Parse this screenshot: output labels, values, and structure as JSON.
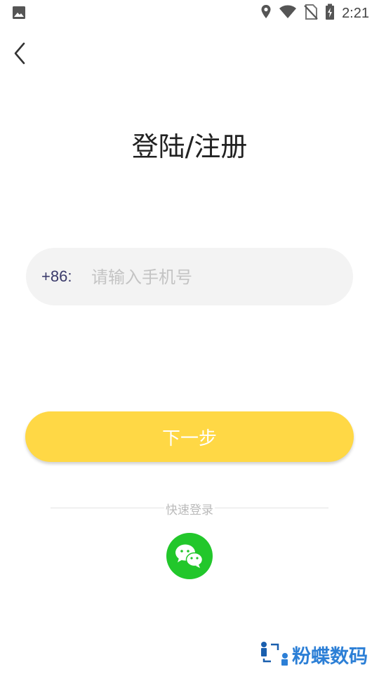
{
  "status_bar": {
    "time": "2:21",
    "icons": [
      "image-icon",
      "location-icon",
      "wifi-icon",
      "no-sim-icon",
      "battery-charging-icon"
    ]
  },
  "header": {
    "back_icon": "chevron-left-icon"
  },
  "title": "登陆/注册",
  "phone_input": {
    "country_code": "+86:",
    "placeholder": "请输入手机号",
    "value": ""
  },
  "next_button": {
    "label": "下一步"
  },
  "quick_login": {
    "label": "快速登录",
    "wechat_icon": "wechat-icon"
  },
  "watermark": {
    "text": "粉蝶数码"
  },
  "colors": {
    "accent": "#ffd845",
    "wechat": "#22c72b",
    "input_bg": "#f3f3f3",
    "watermark": "#2c7fd6"
  }
}
